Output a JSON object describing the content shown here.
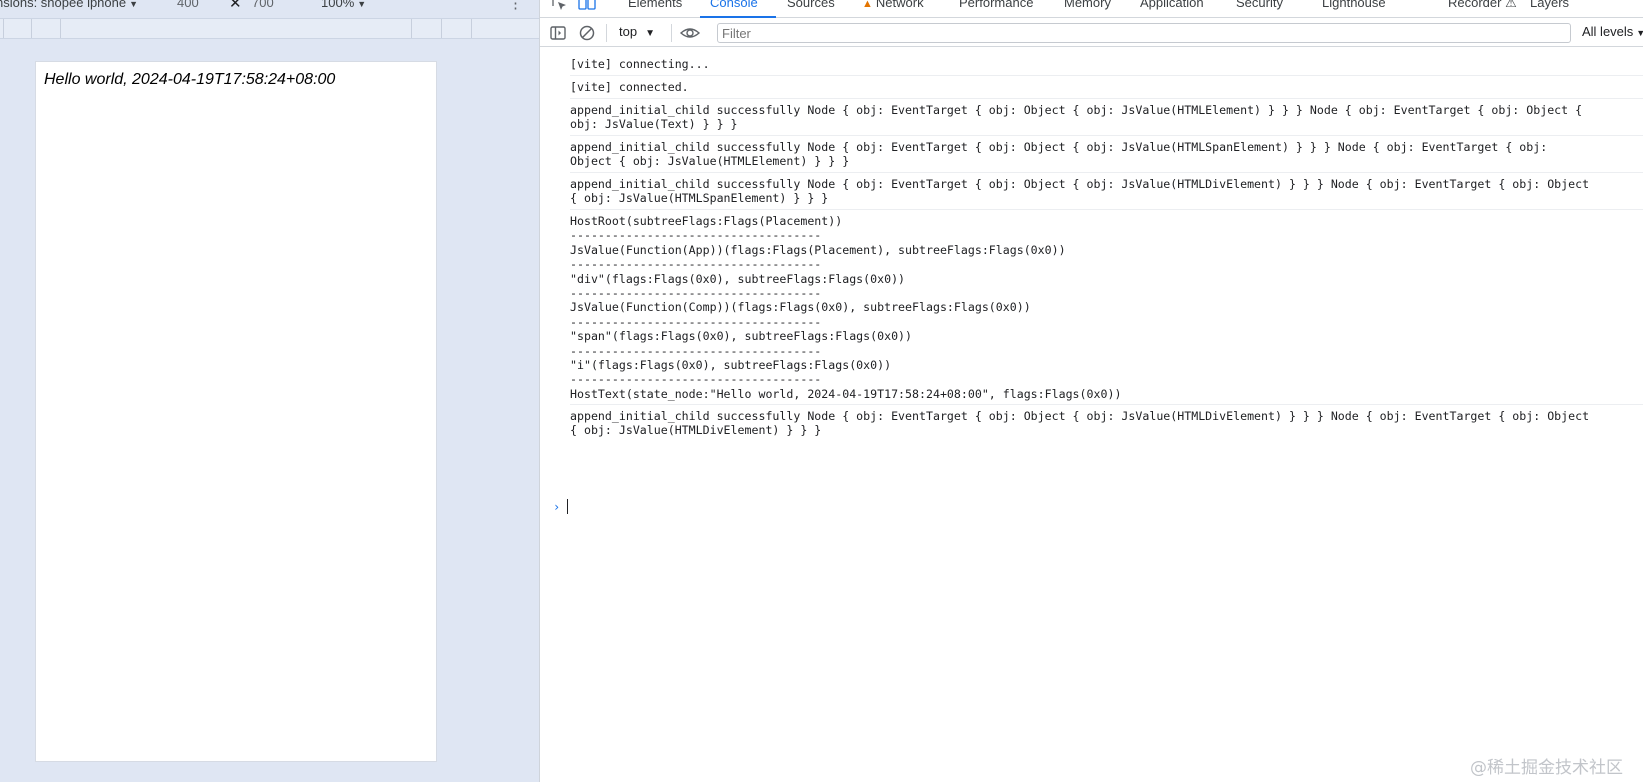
{
  "device_toolbar": {
    "dimensions_label": "nsions: shopee iphone",
    "width": "400",
    "times": "✕",
    "height": "700",
    "zoom": "100%",
    "more": "⋮"
  },
  "page": {
    "hello_text": "Hello world, 2024-04-19T17:58:24+08:00"
  },
  "devtools": {
    "tabs": [
      {
        "label": "Elements"
      },
      {
        "label": "Console"
      },
      {
        "label": "Sources"
      },
      {
        "label": "Network"
      },
      {
        "label": "Performance"
      },
      {
        "label": "Memory"
      },
      {
        "label": "Application"
      },
      {
        "label": "Security"
      },
      {
        "label": "Lighthouse"
      },
      {
        "label": "Recorder"
      },
      {
        "label": "Layers"
      }
    ],
    "active_tab": "Console",
    "accent": "#1a73e8",
    "warning_color": "#e37400"
  },
  "console_toolbar": {
    "context": "top",
    "filter_placeholder": "Filter",
    "levels": "All levels"
  },
  "console": {
    "messages": [
      "[vite] connecting...",
      "[vite] connected.",
      "append_initial_child successfully Node { obj: EventTarget { obj: Object { obj: JsValue(HTMLElement) } } } Node { obj: EventTarget { obj: Object {\nobj: JsValue(Text) } } }",
      "append_initial_child successfully Node { obj: EventTarget { obj: Object { obj: JsValue(HTMLSpanElement) } } } Node { obj: EventTarget { obj:\nObject { obj: JsValue(HTMLElement) } } }",
      "append_initial_child successfully Node { obj: EventTarget { obj: Object { obj: JsValue(HTMLDivElement) } } } Node { obj: EventTarget { obj: Object\n{ obj: JsValue(HTMLSpanElement) } } }",
      "HostRoot(subtreeFlags:Flags(Placement))\n------------------------------------\nJsValue(Function(App))(flags:Flags(Placement), subtreeFlags:Flags(0x0))\n------------------------------------\n\"div\"(flags:Flags(0x0), subtreeFlags:Flags(0x0))\n------------------------------------\nJsValue(Function(Comp))(flags:Flags(0x0), subtreeFlags:Flags(0x0))\n------------------------------------\n\"span\"(flags:Flags(0x0), subtreeFlags:Flags(0x0))\n------------------------------------\n\"i\"(flags:Flags(0x0), subtreeFlags:Flags(0x0))\n------------------------------------\nHostText(state_node:\"Hello world, 2024-04-19T17:58:24+08:00\", flags:Flags(0x0))",
      "append_initial_child successfully Node { obj: EventTarget { obj: Object { obj: JsValue(HTMLDivElement) } } } Node { obj: EventTarget { obj: Object\n{ obj: JsValue(HTMLDivElement) } } }"
    ],
    "prompt_symbol": "›"
  },
  "watermark": "@稀土掘金技术社区"
}
